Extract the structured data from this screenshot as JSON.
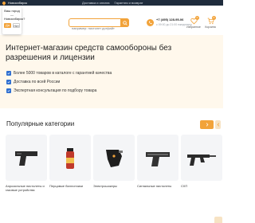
{
  "topbar": {
    "city": "Новосибирск",
    "links": [
      "Доставка и оплата",
      "Гарантия и возврат",
      "Контакты",
      "Заказать звонок"
    ]
  },
  "city_popover": {
    "question": "Ваш город — Новосибирск?",
    "yes": "Да",
    "no": "Нет"
  },
  "header": {
    "search_placeholder": "например: пистолет догфайт",
    "phone": "+7 (495) 128-95-06",
    "worktime": "с 09:00 до 21:00 ежедневно",
    "favorites_label": "Избранное",
    "favorites_count": "0",
    "cart_label": "Корзина",
    "cart_count": "0"
  },
  "hero": {
    "title": "Интернет-магазин средств самообороны без разрешения и лицензии",
    "benefits": [
      "Более 5000 товаров в каталоге с гарантией качества",
      "Доставка по всей России",
      "Экспертная консультация по подбору товара"
    ]
  },
  "categories": {
    "heading": "Популярные категории",
    "items": [
      {
        "label": "Аэрозольные пистолеты и газовые устройства"
      },
      {
        "label": "Перцовые баллончики"
      },
      {
        "label": "Электрошокеры"
      },
      {
        "label": "Сигнальные пистолеты"
      },
      {
        "label": "СХП"
      }
    ]
  },
  "colors": {
    "accent": "#f2a33a",
    "topbar": "#1f2c3c",
    "hero_bg": "#fff8ec",
    "benefit_icon": "#2f6fd1"
  }
}
